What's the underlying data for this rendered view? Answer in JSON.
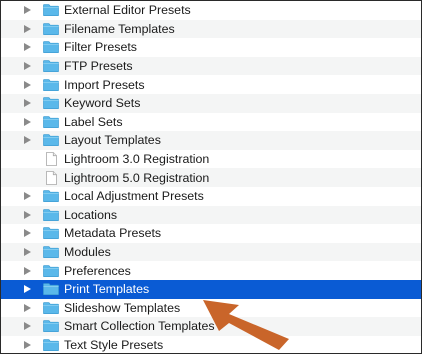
{
  "items": [
    {
      "label": "External Editor Presets",
      "type": "folder",
      "selected": false
    },
    {
      "label": "Filename Templates",
      "type": "folder",
      "selected": false
    },
    {
      "label": "Filter Presets",
      "type": "folder",
      "selected": false
    },
    {
      "label": "FTP Presets",
      "type": "folder",
      "selected": false
    },
    {
      "label": "Import Presets",
      "type": "folder",
      "selected": false
    },
    {
      "label": "Keyword Sets",
      "type": "folder",
      "selected": false
    },
    {
      "label": "Label Sets",
      "type": "folder",
      "selected": false
    },
    {
      "label": "Layout Templates",
      "type": "folder",
      "selected": false
    },
    {
      "label": "Lightroom 3.0 Registration",
      "type": "file",
      "selected": false
    },
    {
      "label": "Lightroom 5.0 Registration",
      "type": "file",
      "selected": false
    },
    {
      "label": "Local Adjustment Presets",
      "type": "folder",
      "selected": false
    },
    {
      "label": "Locations",
      "type": "folder",
      "selected": false
    },
    {
      "label": "Metadata Presets",
      "type": "folder",
      "selected": false
    },
    {
      "label": "Modules",
      "type": "folder",
      "selected": false
    },
    {
      "label": "Preferences",
      "type": "folder",
      "selected": false
    },
    {
      "label": "Print Templates",
      "type": "folder",
      "selected": true
    },
    {
      "label": "Slideshow Templates",
      "type": "folder",
      "selected": false
    },
    {
      "label": "Smart Collection Templates",
      "type": "folder",
      "selected": false
    },
    {
      "label": "Text Style Presets",
      "type": "folder",
      "selected": false
    }
  ],
  "colors": {
    "selection": "#0a5bd4",
    "folder": "#5ab8ea",
    "arrow": "#c9652a"
  },
  "icons": {
    "folder": "folder-icon",
    "file": "document-icon",
    "disclosure": "disclosure-triangle-icon",
    "annotation": "annotation-arrow"
  }
}
